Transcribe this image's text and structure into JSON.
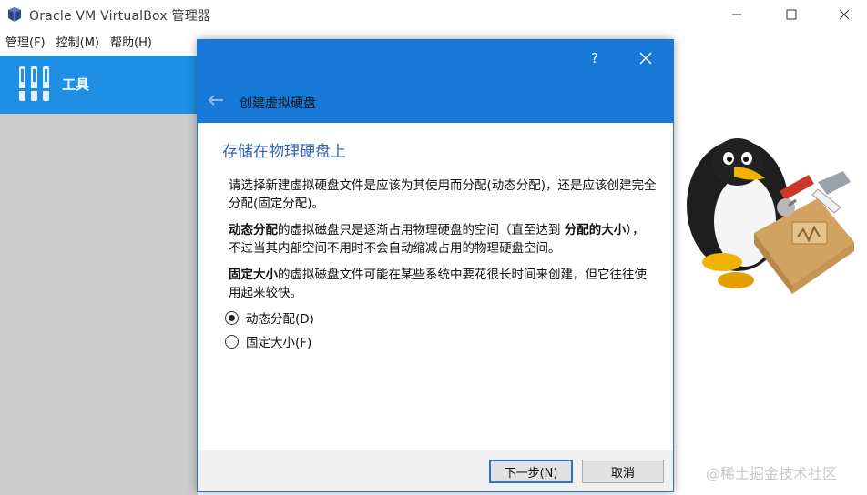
{
  "window": {
    "title": "Oracle VM VirtualBox 管理器",
    "controls": {
      "minimize": "—",
      "maximize": "□",
      "close": "✕"
    }
  },
  "menubar": {
    "items": [
      "管理(F)",
      "控制(M)",
      "帮助(H)"
    ]
  },
  "sidebar": {
    "tools_label": "工具"
  },
  "dialog": {
    "help_label": "?",
    "heading": "创建虚拟硬盘",
    "section_title": "存储在物理硬盘上",
    "para1": "请选择新建虚拟硬盘文件是应该为其使用而分配(动态分配)，还是应该创建完全分配(固定分配)。",
    "para2_bold1": "动态分配",
    "para2_text1": "的虚拟磁盘只是逐渐占用物理硬盘的空间（直至达到 ",
    "para2_bold2": "分配的大小",
    "para2_text2": "），不过当其内部空间不用时不会自动缩减占用的物理硬盘空间。",
    "para3_bold": "固定大小",
    "para3_text": "的虚拟磁盘文件可能在某些系统中要花很长时间来创建，但它往往使用起来较快。",
    "options": [
      {
        "label": "动态分配(D)",
        "selected": true
      },
      {
        "label": "固定大小(F)",
        "selected": false
      }
    ],
    "buttons": {
      "next": "下一步(N)",
      "cancel": "取消"
    }
  },
  "watermark": "@稀土掘金技术社区",
  "colors": {
    "accent": "#1679d7",
    "sidebar_tools": "#1e8fe4",
    "section_title": "#2f62b0"
  }
}
